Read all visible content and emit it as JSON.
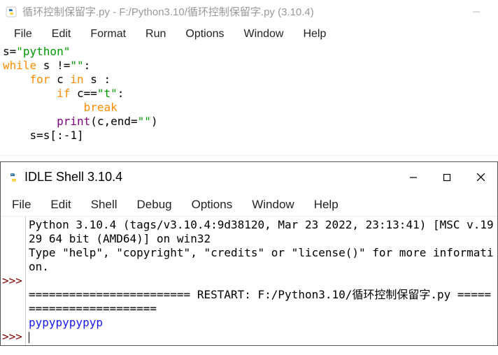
{
  "editor": {
    "title": "循环控制保留字.py - F:/Python3.10/循环控制保留字.py (3.10.4)",
    "menu": [
      "File",
      "Edit",
      "Format",
      "Run",
      "Options",
      "Window",
      "Help"
    ],
    "minimize_tip": "Minimize",
    "code": {
      "l1": {
        "a": "s=",
        "b": "\"python\""
      },
      "l2": {
        "a": "while",
        "b": " s !=",
        "c": "\"\"",
        "d": ":"
      },
      "l3": {
        "a": "    ",
        "b": "for",
        "c": " c ",
        "d": "in",
        "e": " s :"
      },
      "l4": {
        "a": "        ",
        "b": "if",
        "c": " c==",
        "d": "\"t\"",
        "e": ":"
      },
      "l5": {
        "a": "            ",
        "b": "break"
      },
      "l6": {
        "a": "        ",
        "b": "print",
        "c": "(c,end=",
        "d": "\"\"",
        "e": ")"
      },
      "l7": {
        "a": "    s=s[:-1]"
      }
    }
  },
  "shell": {
    "title": "IDLE Shell 3.10.4",
    "menu": [
      "File",
      "Edit",
      "Shell",
      "Debug",
      "Options",
      "Window",
      "Help"
    ],
    "minimize_tip": "Minimize",
    "maximize_tip": "Maximize",
    "close_tip": "Close",
    "banner1": "Python 3.10.4 (tags/v3.10.4:9d38120, Mar 23 2022, 23:13:41) [MSC v.1929 64 bit (AMD64)] on win32",
    "banner2": "Type \"help\", \"copyright\", \"credits\" or \"license()\" for more information.",
    "prompt": ">>>",
    "divider1": "========================",
    "restart_label": " RESTART: ",
    "restart_path": "F:/Python3.10/循环控制保留字.py ",
    "divider2": "========================",
    "output": "pypypypypyp"
  }
}
